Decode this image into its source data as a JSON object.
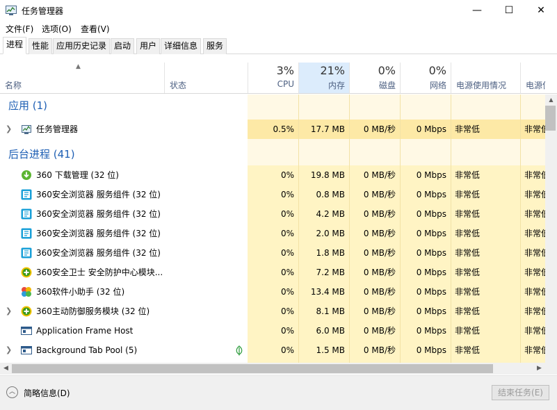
{
  "window": {
    "title": "任务管理器",
    "minimize_glyph": "—",
    "maximize_glyph": "☐",
    "close_glyph": "✕"
  },
  "menu": [
    "文件(F)",
    "选项(O)",
    "查看(V)"
  ],
  "tabs": [
    "进程",
    "性能",
    "应用历史记录",
    "启动",
    "用户",
    "详细信息",
    "服务"
  ],
  "columns": {
    "name": "名称",
    "status": "状态",
    "cpu": {
      "pct": "3%",
      "label": "CPU"
    },
    "memory": {
      "pct": "21%",
      "label": "内存"
    },
    "disk": {
      "pct": "0%",
      "label": "磁盘"
    },
    "network": {
      "pct": "0%",
      "label": "网络"
    },
    "power": "电源使用情况",
    "power_trend": "电源使用"
  },
  "groups": {
    "apps": "应用 (1)",
    "background": "后台进程 (41)"
  },
  "rows": [
    {
      "name": "任务管理器",
      "cpu": "0.5%",
      "mem": "17.7 MB",
      "disk": "0 MB/秒",
      "net": "0 Mbps",
      "power": "非常低",
      "trend": "非常低"
    },
    {
      "name": "360 下载管理 (32 位)",
      "cpu": "0%",
      "mem": "19.8 MB",
      "disk": "0 MB/秒",
      "net": "0 Mbps",
      "power": "非常低",
      "trend": "非常低"
    },
    {
      "name": "360安全浏览器 服务组件 (32 位)",
      "cpu": "0%",
      "mem": "0.8 MB",
      "disk": "0 MB/秒",
      "net": "0 Mbps",
      "power": "非常低",
      "trend": "非常低"
    },
    {
      "name": "360安全浏览器 服务组件 (32 位)",
      "cpu": "0%",
      "mem": "4.2 MB",
      "disk": "0 MB/秒",
      "net": "0 Mbps",
      "power": "非常低",
      "trend": "非常低"
    },
    {
      "name": "360安全浏览器 服务组件 (32 位)",
      "cpu": "0%",
      "mem": "2.0 MB",
      "disk": "0 MB/秒",
      "net": "0 Mbps",
      "power": "非常低",
      "trend": "非常低"
    },
    {
      "name": "360安全浏览器 服务组件 (32 位)",
      "cpu": "0%",
      "mem": "1.8 MB",
      "disk": "0 MB/秒",
      "net": "0 Mbps",
      "power": "非常低",
      "trend": "非常低"
    },
    {
      "name": "360安全卫士 安全防护中心模块...",
      "cpu": "0%",
      "mem": "7.2 MB",
      "disk": "0 MB/秒",
      "net": "0 Mbps",
      "power": "非常低",
      "trend": "非常低"
    },
    {
      "name": "360软件小助手 (32 位)",
      "cpu": "0%",
      "mem": "13.4 MB",
      "disk": "0 MB/秒",
      "net": "0 Mbps",
      "power": "非常低",
      "trend": "非常低"
    },
    {
      "name": "360主动防御服务模块 (32 位)",
      "cpu": "0%",
      "mem": "8.1 MB",
      "disk": "0 MB/秒",
      "net": "0 Mbps",
      "power": "非常低",
      "trend": "非常低"
    },
    {
      "name": "Application Frame Host",
      "cpu": "0%",
      "mem": "6.0 MB",
      "disk": "0 MB/秒",
      "net": "0 Mbps",
      "power": "非常低",
      "trend": "非常低"
    },
    {
      "name": "Background Tab Pool (5)",
      "cpu": "0%",
      "mem": "1.5 MB",
      "disk": "0 MB/秒",
      "net": "0 Mbps",
      "power": "非常低",
      "trend": "非常低"
    }
  ],
  "footer": {
    "fewer_details": "简略信息(D)",
    "end_task": "结束任务(E)"
  },
  "colors": {
    "heat_light": "#fff4c4",
    "heat_mid": "#fde9a6",
    "heat_group": "#fff9e5",
    "group_title": "#1e5fb4"
  }
}
